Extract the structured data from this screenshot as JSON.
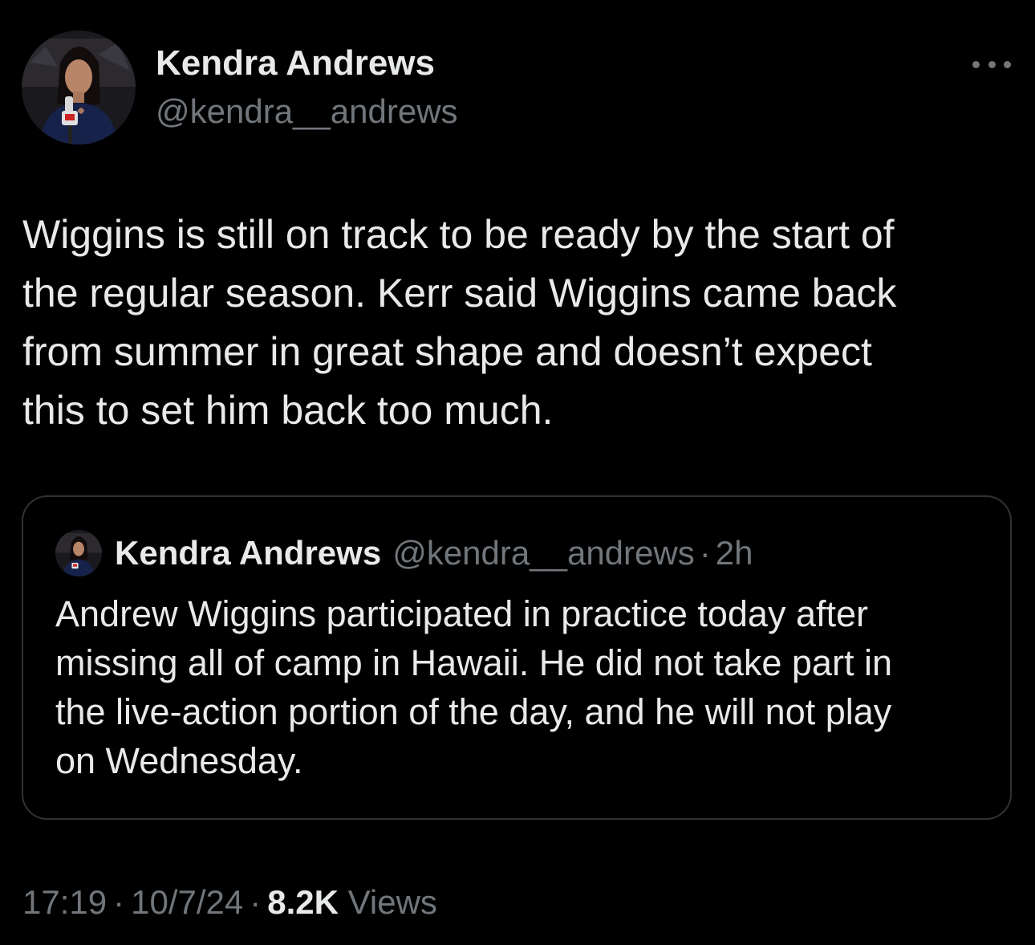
{
  "author": {
    "display_name": "Kendra Andrews",
    "handle": "@kendra__andrews"
  },
  "tweet": {
    "text": "Wiggins is still on track to be ready by the start of\nthe regular season. Kerr said Wiggins came back\nfrom summer in great shape and doesn’t expect\nthis to set him back too much."
  },
  "quoted_tweet": {
    "display_name": "Kendra Andrews",
    "handle": "@kendra__andrews",
    "separator": "·",
    "time_ago": "2h",
    "text": "Andrew Wiggins participated in practice today after\nmissing all of camp in Hawaii. He did not take part in\nthe live-action portion of the day, and he will not play\non Wednesday."
  },
  "meta": {
    "time": "17:19",
    "separator": "·",
    "date": "10/7/24",
    "views_count": "8.2K",
    "views_label": "Views"
  },
  "icons": {
    "more": "more-options-icon"
  },
  "colors": {
    "background": "#000000",
    "primary_text": "#e7e9ea",
    "secondary_text": "#71767b",
    "border": "#2f3336"
  }
}
